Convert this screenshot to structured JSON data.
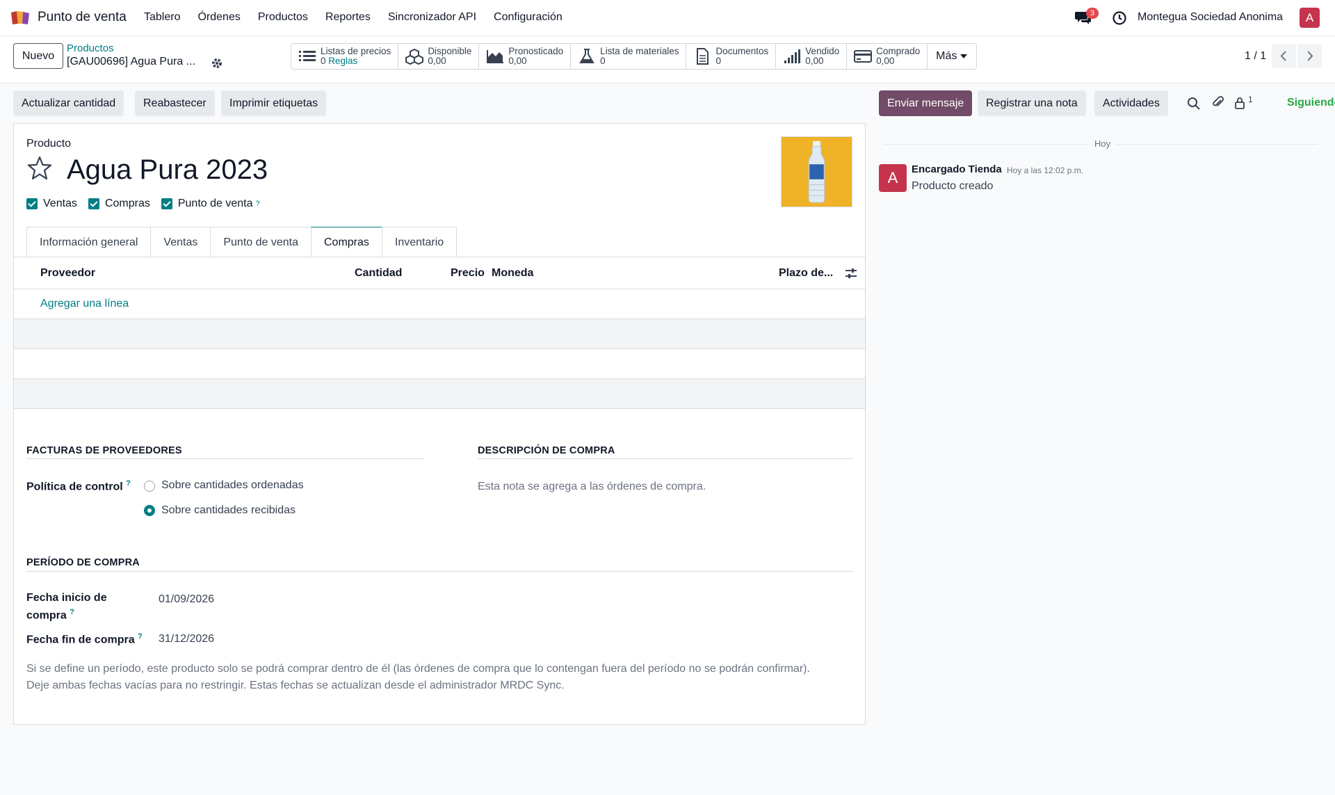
{
  "app": {
    "name": "Punto de venta"
  },
  "menu": [
    "Tablero",
    "Órdenes",
    "Productos",
    "Reportes",
    "Sincronizador API",
    "Configuración"
  ],
  "systray": {
    "messages_count": "3",
    "company": "Montegua Sociedad Anonima",
    "user_initial": "A"
  },
  "control": {
    "new_label": "Nuevo",
    "breadcrumb_parent": "Productos",
    "breadcrumb_current": "[GAU00696] Agua Pura ...",
    "pager": "1 / 1"
  },
  "smart_buttons": [
    {
      "icon": "list-icon",
      "label": "Listas de precios",
      "value": "0",
      "value_suffix": "Reglas"
    },
    {
      "icon": "cubes-icon",
      "label": "Disponible",
      "value": "0,00"
    },
    {
      "icon": "area-chart-icon",
      "label": "Pronosticado",
      "value": "0,00"
    },
    {
      "icon": "flask-icon",
      "label": "Lista de materiales",
      "value": "0"
    },
    {
      "icon": "document-icon",
      "label": "Documentos",
      "value": "0"
    },
    {
      "icon": "signal-icon",
      "label": "Vendido",
      "value": "0,00"
    },
    {
      "icon": "credit-card-icon",
      "label": "Comprado",
      "value": "0,00"
    },
    {
      "icon": "caret-down-icon",
      "label": "Más"
    }
  ],
  "actions": {
    "update_qty": "Actualizar cantidad",
    "replenish": "Reabastecer",
    "print_labels": "Imprimir etiquetas",
    "send_message": "Enviar mensaje",
    "log_note": "Registrar una nota",
    "activities": "Actividades",
    "followers_count": "1",
    "follow": "Siguiendo"
  },
  "form": {
    "label_producto": "Producto",
    "product_name": "Agua Pura 2023",
    "checks": [
      "Ventas",
      "Compras",
      "Punto de venta"
    ],
    "help_mark": "?",
    "tabs": [
      "Información general",
      "Ventas",
      "Punto de venta",
      "Compras",
      "Inventario"
    ],
    "active_tab": "Compras",
    "grid_columns": [
      "Proveedor",
      "Cantidad",
      "Precio",
      "Moneda",
      "Plazo de..."
    ],
    "add_line": "Agregar una línea",
    "vendor_bills_title": "FACTURAS DE PROVEEDORES",
    "control_policy_label": "Política de control",
    "control_policy_options": [
      "Sobre cantidades ordenadas",
      "Sobre cantidades recibidas"
    ],
    "control_policy_selected": "Sobre cantidades recibidas",
    "purchase_desc_title": "DESCRIPCIÓN DE COMPRA",
    "purchase_desc_placeholder": "Esta nota se agrega a las órdenes de compra.",
    "purchase_period_title": "PERÍODO DE COMPRA",
    "start_date_label_1": "Fecha inicio de",
    "start_date_label_2": "compra",
    "start_date": "01/09/2026",
    "end_date_label": "Fecha fin de compra",
    "end_date": "31/12/2026",
    "help_text_1": "Si se define un período, este producto solo se podrá comprar dentro de él (las órdenes de compra que lo contengan fuera del período no se podrán confirmar).",
    "help_text_2": "Deje ambas fechas vacías para no restringir. Estas fechas se actualizan desde el administrador MRDC Sync."
  },
  "chatter": {
    "day": "Hoy",
    "author": "Encargado Tienda",
    "author_initial": "A",
    "time": "Hoy a las 12:02 p.m.",
    "body": "Producto creado"
  },
  "colors": {
    "brand": "#714b67",
    "accent": "#017e84",
    "product_image_bg": "#f0b227",
    "avatar": "#c5334d"
  }
}
